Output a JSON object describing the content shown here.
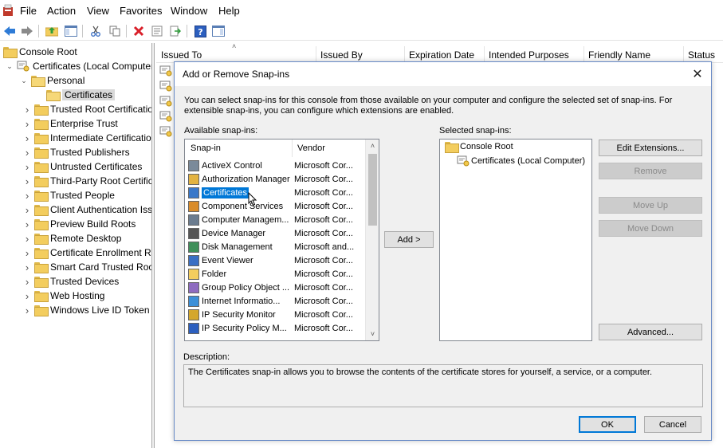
{
  "menu": [
    "File",
    "Action",
    "View",
    "Favorites",
    "Window",
    "Help"
  ],
  "tree": {
    "root": "Console Root",
    "computer": "Certificates (Local Computer)",
    "personal": "Personal",
    "certificates": "Certificates",
    "stores": [
      "Trusted Root Certification Authorities",
      "Enterprise Trust",
      "Intermediate Certification Authorities",
      "Trusted Publishers",
      "Untrusted Certificates",
      "Third-Party Root Certification Authorities",
      "Trusted People",
      "Client Authentication Issuers",
      "Preview Build Roots",
      "Remote Desktop",
      "Certificate Enrollment Requests",
      "Smart Card Trusted Roots",
      "Trusted Devices",
      "Web Hosting",
      "Windows Live ID Token Issuer"
    ]
  },
  "list": {
    "columns": [
      "Issued To",
      "Issued By",
      "Expiration Date",
      "Intended Purposes",
      "Friendly Name",
      "Status"
    ]
  },
  "dialog": {
    "title": "Add or Remove Snap-ins",
    "intro": "You can select snap-ins for this console from those available on your computer and configure the selected set of snap-ins. For extensible snap-ins, you can configure which extensions are enabled.",
    "available_label": "Available snap-ins:",
    "selected_label": "Selected snap-ins:",
    "col_snapin": "Snap-in",
    "col_vendor": "Vendor",
    "available": [
      {
        "name": "ActiveX Control",
        "vendor": "Microsoft Cor..."
      },
      {
        "name": "Authorization Manager",
        "vendor": "Microsoft Cor..."
      },
      {
        "name": "Certificates",
        "vendor": "Microsoft Cor..."
      },
      {
        "name": "Component Services",
        "vendor": "Microsoft Cor..."
      },
      {
        "name": "Computer Managem...",
        "vendor": "Microsoft Cor..."
      },
      {
        "name": "Device Manager",
        "vendor": "Microsoft Cor..."
      },
      {
        "name": "Disk Management",
        "vendor": "Microsoft and..."
      },
      {
        "name": "Event Viewer",
        "vendor": "Microsoft Cor..."
      },
      {
        "name": "Folder",
        "vendor": "Microsoft Cor..."
      },
      {
        "name": "Group Policy Object ...",
        "vendor": "Microsoft Cor..."
      },
      {
        "name": "Internet Informatio...",
        "vendor": "Microsoft Cor..."
      },
      {
        "name": "IP Security Monitor",
        "vendor": "Microsoft Cor..."
      },
      {
        "name": "IP Security Policy M...",
        "vendor": "Microsoft Cor..."
      }
    ],
    "selected_root": "Console Root",
    "selected_child": "Certificates (Local Computer)",
    "buttons": {
      "add": "Add >",
      "edit_extensions": "Edit Extensions...",
      "remove": "Remove",
      "move_up": "Move Up",
      "move_down": "Move Down",
      "advanced": "Advanced...",
      "ok": "OK",
      "cancel": "Cancel"
    },
    "description_label": "Description:",
    "description": "The Certificates snap-in allows you to browse the contents of the certificate stores for yourself, a service, or a computer."
  }
}
